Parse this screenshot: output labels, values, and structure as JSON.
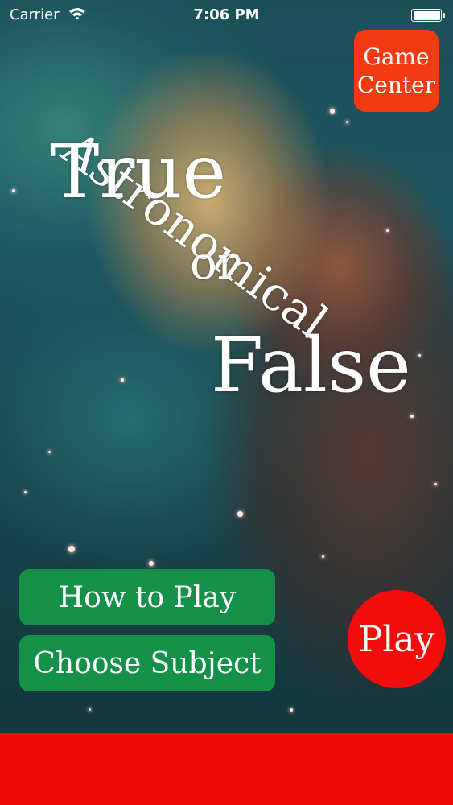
{
  "status_bar": {
    "carrier": "Carrier",
    "time": "7:06 PM",
    "icons": [
      "wifi-icon",
      "battery-icon"
    ]
  },
  "title": {
    "line1": "Astronomical",
    "line2": "True",
    "line3": "or",
    "line4": "False"
  },
  "game_center": {
    "line1": "Game",
    "line2": "Center"
  },
  "menu": {
    "how_to_play": "How to Play",
    "choose_subject": "Choose Subject",
    "play": "Play"
  },
  "colors": {
    "game_center_bg": "#f33a12",
    "menu_button_bg": "#149048",
    "play_button_bg": "#f20c0c",
    "ad_banner_bg": "#f20a0a"
  }
}
